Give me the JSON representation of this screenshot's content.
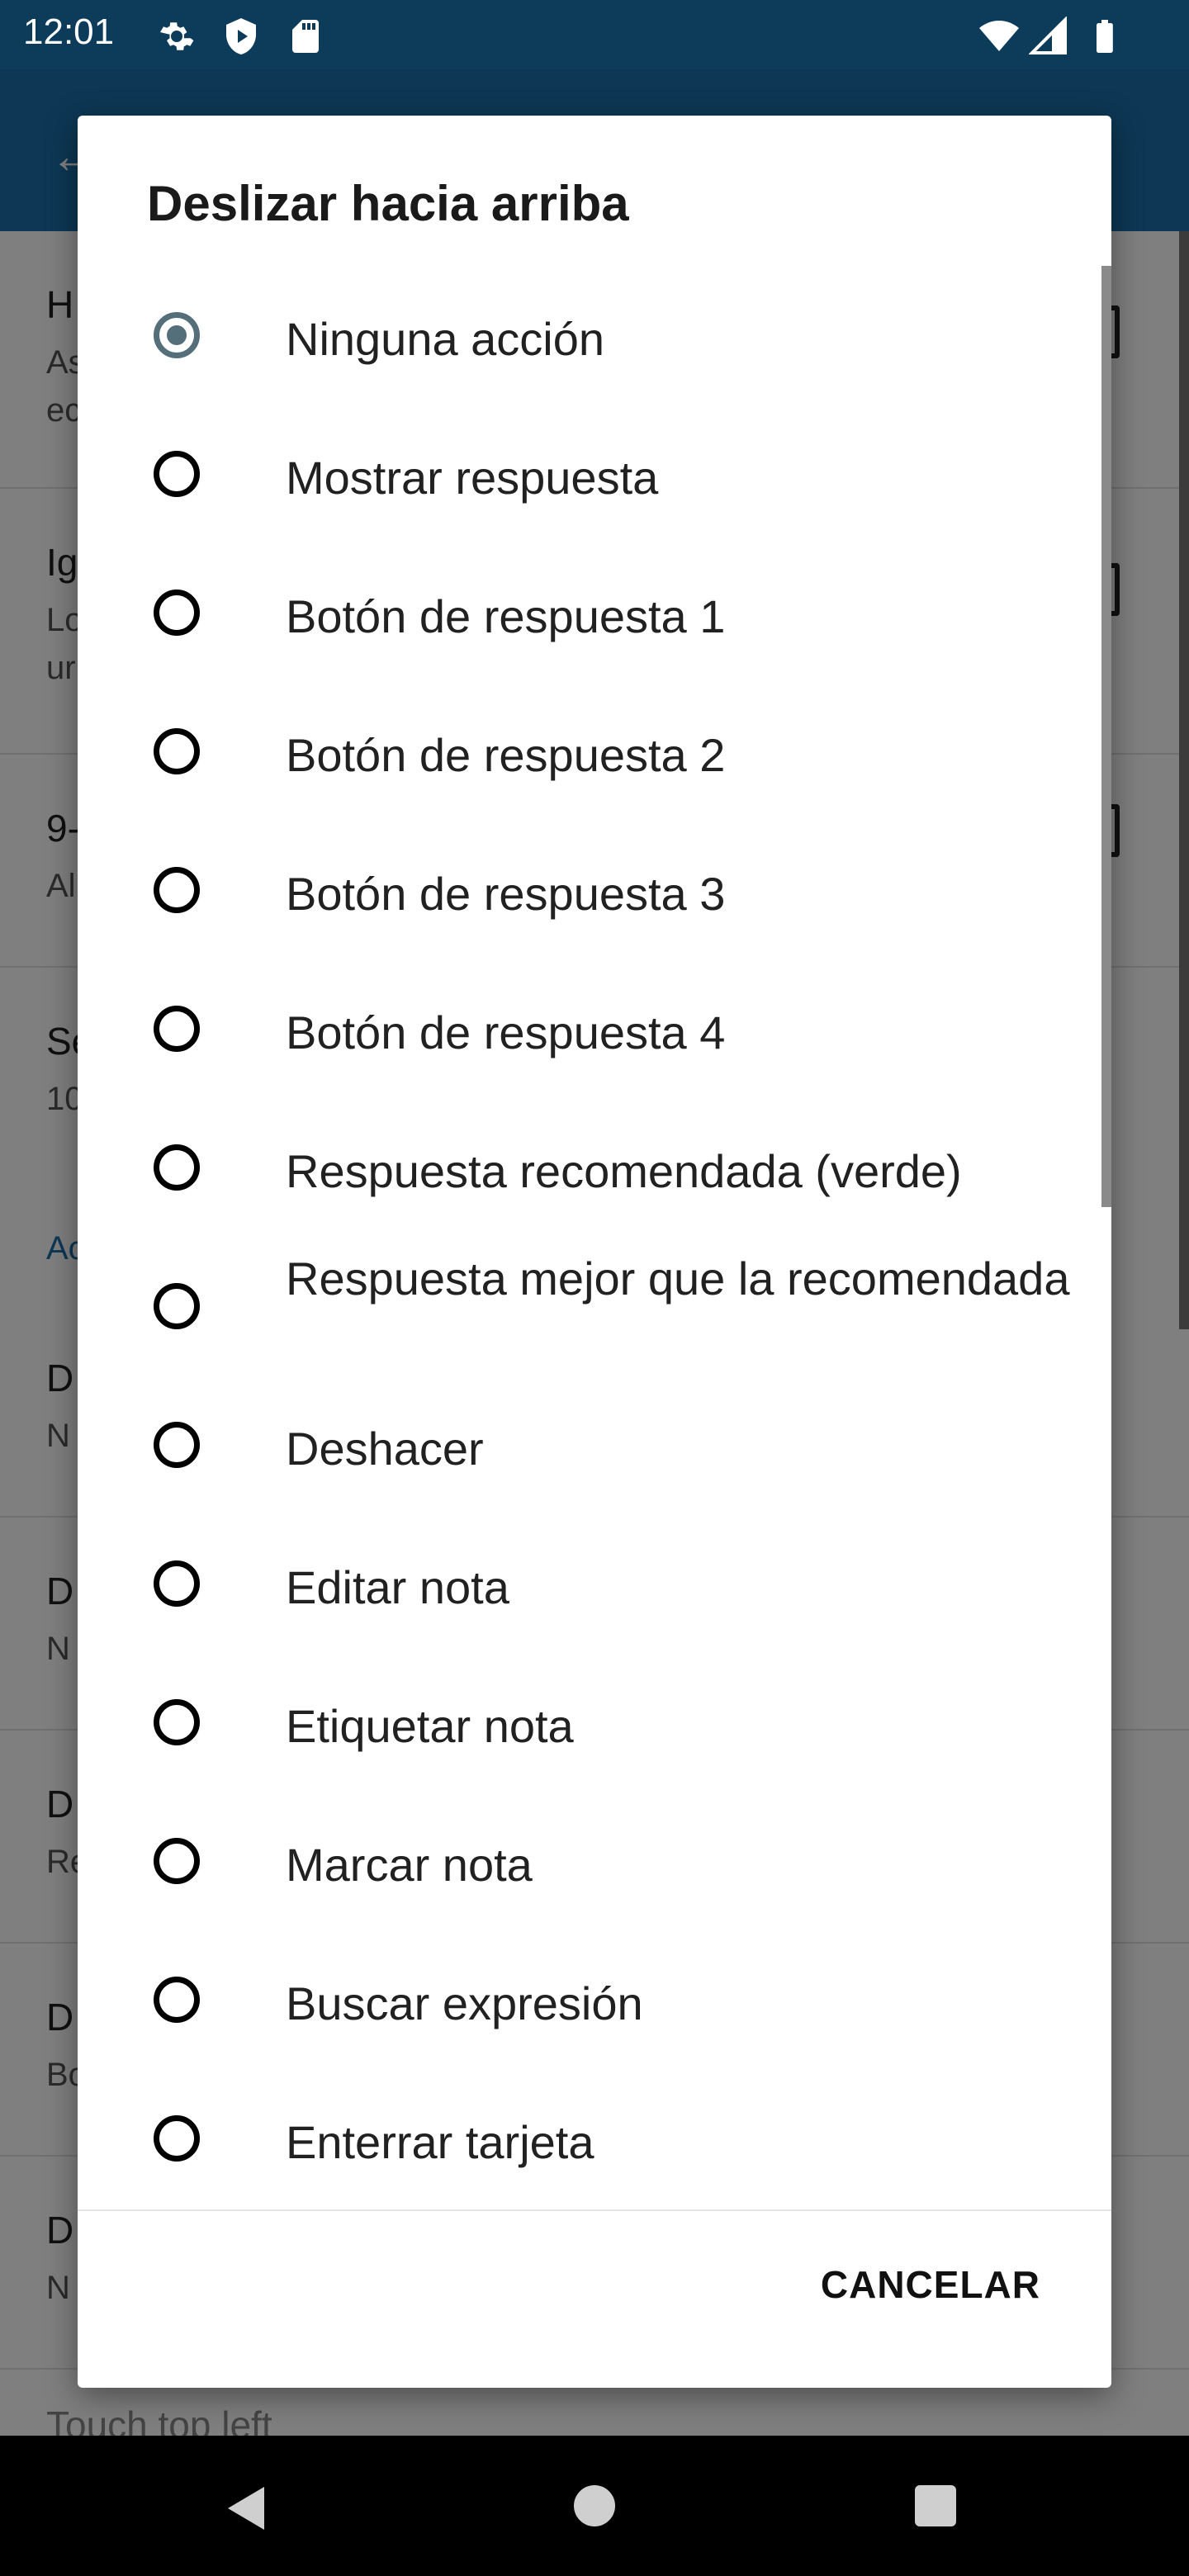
{
  "status_bar": {
    "time": "12:01",
    "icons": [
      "settings-icon",
      "shield-icon",
      "sd-card-icon",
      "wifi-icon",
      "signal-icon",
      "battery-icon"
    ]
  },
  "dialog": {
    "title": "Deslizar hacia arriba",
    "options": [
      {
        "label": "Ninguna acción",
        "selected": true
      },
      {
        "label": "Mostrar respuesta",
        "selected": false
      },
      {
        "label": "Botón de respuesta 1",
        "selected": false
      },
      {
        "label": "Botón de respuesta 2",
        "selected": false
      },
      {
        "label": "Botón de respuesta 3",
        "selected": false
      },
      {
        "label": "Botón de respuesta 4",
        "selected": false
      },
      {
        "label": "Respuesta recomendada (verde)",
        "selected": false
      },
      {
        "label": "Respuesta mejor que la recomendada",
        "selected": false
      },
      {
        "label": "Deshacer",
        "selected": false
      },
      {
        "label": "Editar nota",
        "selected": false
      },
      {
        "label": "Etiquetar nota",
        "selected": false
      },
      {
        "label": "Marcar nota",
        "selected": false
      },
      {
        "label": "Buscar expresión",
        "selected": false
      },
      {
        "label": "Enterrar tarjeta",
        "selected": false
      }
    ],
    "cancel_label": "CANCELAR"
  },
  "background": {
    "rows": [
      {
        "title": "H",
        "subtitle": "As\nec"
      },
      {
        "title": "Ig",
        "subtitle": "Lo\nur"
      },
      {
        "title": "9-",
        "subtitle": "Al"
      },
      {
        "title": "Se",
        "subtitle": "10"
      },
      {
        "title": "D",
        "subtitle": "N"
      },
      {
        "title": "D",
        "subtitle": "N"
      },
      {
        "title": "D",
        "subtitle": "Re"
      },
      {
        "title": "D",
        "subtitle": "Bo"
      },
      {
        "title": "D",
        "subtitle": "N"
      }
    ],
    "section_header": "Ac",
    "footer_text": "Touch top left"
  },
  "colors": {
    "status_bar": "#0d3b5a",
    "app_bar": "#1a6fa8",
    "radio_selected": "#546e7a"
  }
}
